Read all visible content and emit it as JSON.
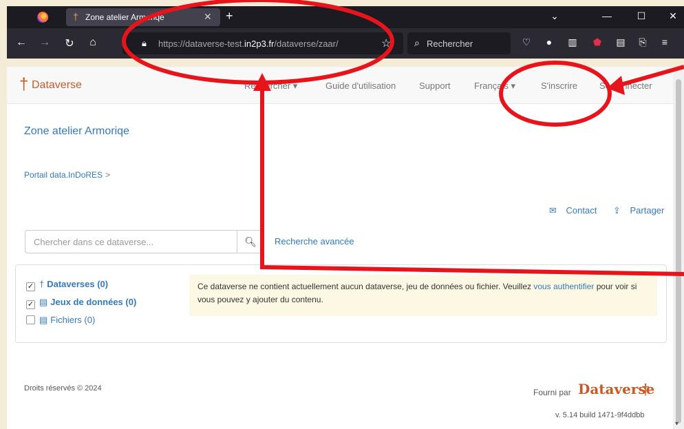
{
  "browser": {
    "tab_title": "Zone atelier Armoriqe",
    "url_prefix": "https://dataverse-test.",
    "url_domain": "in2p3.fr",
    "url_path": "/dataverse/zaar/",
    "search_placeholder": "Rechercher",
    "icons": [
      "firefox-logo",
      "back-arrow",
      "forward-arrow",
      "reload",
      "home",
      "lock",
      "bookmark-star",
      "search",
      "pocket",
      "extension",
      "library",
      "ublock",
      "reader",
      "share",
      "menu"
    ]
  },
  "site_nav": {
    "brand": "Dataverse",
    "links": [
      "Rechercher ▾",
      "Guide d'utilisation",
      "Support",
      "Français ▾",
      "S'inscrire",
      "Se connecter"
    ]
  },
  "main": {
    "title": "Zone atelier Armoriqe",
    "breadcrumb": "Portail data.InDoRES",
    "breadcrumb_sep": ">",
    "contact_label": "Contact",
    "share_label": "Partager",
    "search_placeholder": "Chercher dans ce dataverse...",
    "advanced_search": "Recherche avancée"
  },
  "facets": [
    {
      "label": "Dataverses (0)",
      "checked": true
    },
    {
      "label": "Jeux de données (0)",
      "checked": true
    },
    {
      "label": "Fichiers (0)",
      "checked": false
    }
  ],
  "notice": {
    "before": "Ce dataverse ne contient actuellement aucun dataverse, jeu de données ou fichier. Veuillez ",
    "link": "vous authentifier",
    "after": " pour voir si vous pouvez y ajouter du contenu."
  },
  "footer": {
    "copyright": "Droits réservés © 2024",
    "powered_by": "Fourni par",
    "logo": "Dataverse",
    "version": "v. 5.14 build 1471-9f4ddbb"
  },
  "colors": {
    "brand": "#c55b28",
    "link": "#337ab7",
    "annotation": "#e8141b"
  }
}
